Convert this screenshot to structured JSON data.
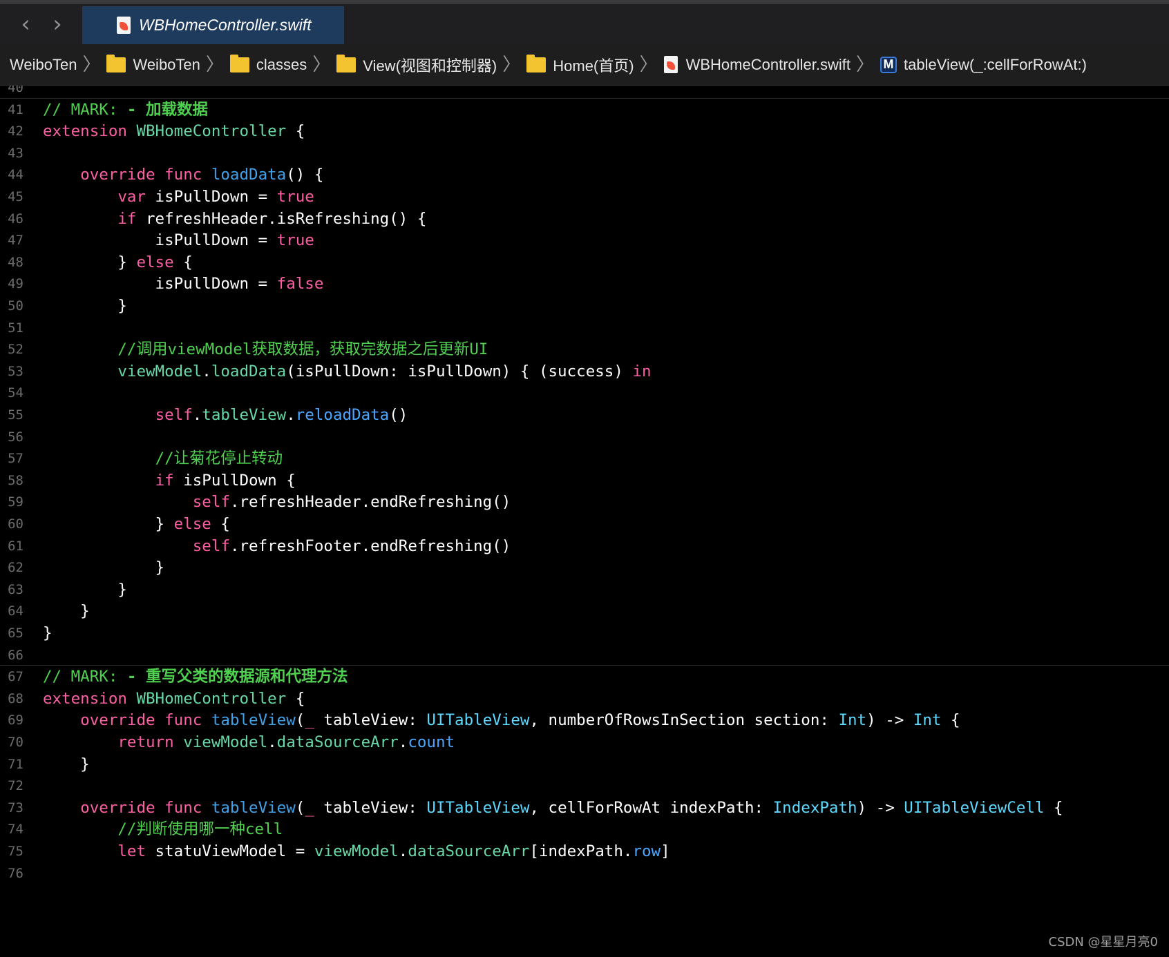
{
  "tab_bar": {
    "back_arrow": "chevron-left-icon",
    "forward_arrow": "chevron-right-icon",
    "active_tab": {
      "label": "WBHomeController.swift",
      "icon": "swift-file-icon"
    }
  },
  "breadcrumb": [
    {
      "label": "WeiboTen",
      "icon": ""
    },
    {
      "label": "WeiboTen",
      "icon": "folder-icon"
    },
    {
      "label": "classes",
      "icon": "folder-icon"
    },
    {
      "label": "View(视图和控制器)",
      "icon": "folder-icon"
    },
    {
      "label": "Home(首页)",
      "icon": "folder-icon"
    },
    {
      "label": "WBHomeController.swift",
      "icon": "swift-file-icon"
    },
    {
      "label": "tableView(_:cellForRowAt:)",
      "icon": "method-icon",
      "icon_text": "M"
    }
  ],
  "colors": {
    "keyword": "#fc5fa3",
    "comment": "#4fd04f",
    "type": "#5dd8ff",
    "function": "#41a1e8",
    "project_identifier": "#67d9a8",
    "plain": "#ffffff",
    "line_number": "#6c6c6c",
    "background": "#000000",
    "active_tab": "#1e3a5c"
  },
  "code_lines": [
    {
      "n": "40",
      "tokens": []
    },
    {
      "n": "41",
      "tokens": [
        [
          "comment",
          "// MARK: "
        ],
        [
          "mark",
          "- 加载数据"
        ]
      ]
    },
    {
      "n": "42",
      "tokens": [
        [
          "kw",
          "extension"
        ],
        [
          "plain",
          " "
        ],
        [
          "proj",
          "WBHomeController"
        ],
        [
          "plain",
          " {"
        ]
      ]
    },
    {
      "n": "43",
      "tokens": []
    },
    {
      "n": "44",
      "tokens": [
        [
          "plain",
          "    "
        ],
        [
          "kw",
          "override"
        ],
        [
          "plain",
          " "
        ],
        [
          "kw",
          "func"
        ],
        [
          "plain",
          " "
        ],
        [
          "fn",
          "loadData"
        ],
        [
          "plain",
          "() {"
        ]
      ]
    },
    {
      "n": "45",
      "tokens": [
        [
          "plain",
          "        "
        ],
        [
          "kw",
          "var"
        ],
        [
          "plain",
          " isPullDown = "
        ],
        [
          "kw",
          "true"
        ]
      ]
    },
    {
      "n": "46",
      "tokens": [
        [
          "plain",
          "        "
        ],
        [
          "kw",
          "if"
        ],
        [
          "plain",
          " refreshHeader.isRefreshing() {"
        ]
      ]
    },
    {
      "n": "47",
      "tokens": [
        [
          "plain",
          "            isPullDown = "
        ],
        [
          "kw",
          "true"
        ]
      ]
    },
    {
      "n": "48",
      "tokens": [
        [
          "plain",
          "        } "
        ],
        [
          "kw",
          "else"
        ],
        [
          "plain",
          " {"
        ]
      ]
    },
    {
      "n": "49",
      "tokens": [
        [
          "plain",
          "            isPullDown = "
        ],
        [
          "kw",
          "false"
        ]
      ]
    },
    {
      "n": "50",
      "tokens": [
        [
          "plain",
          "        }"
        ]
      ]
    },
    {
      "n": "51",
      "tokens": []
    },
    {
      "n": "52",
      "tokens": [
        [
          "plain",
          "        "
        ],
        [
          "comment",
          "//调用viewModel获取数据，获取完数据之后更新UI"
        ]
      ]
    },
    {
      "n": "53",
      "tokens": [
        [
          "plain",
          "        "
        ],
        [
          "proj",
          "viewModel"
        ],
        [
          "plain",
          "."
        ],
        [
          "proj",
          "loadData"
        ],
        [
          "plain",
          "(isPullDown: isPullDown) { (success) "
        ],
        [
          "kw",
          "in"
        ]
      ]
    },
    {
      "n": "54",
      "tokens": []
    },
    {
      "n": "55",
      "tokens": [
        [
          "plain",
          "            "
        ],
        [
          "kw",
          "self"
        ],
        [
          "plain",
          "."
        ],
        [
          "proj",
          "tableView"
        ],
        [
          "plain",
          "."
        ],
        [
          "sys",
          "reloadData"
        ],
        [
          "plain",
          "()"
        ]
      ]
    },
    {
      "n": "56",
      "tokens": []
    },
    {
      "n": "57",
      "tokens": [
        [
          "plain",
          "            "
        ],
        [
          "comment",
          "//让菊花停止转动"
        ]
      ]
    },
    {
      "n": "58",
      "tokens": [
        [
          "plain",
          "            "
        ],
        [
          "kw",
          "if"
        ],
        [
          "plain",
          " isPullDown {"
        ]
      ]
    },
    {
      "n": "59",
      "tokens": [
        [
          "plain",
          "                "
        ],
        [
          "kw",
          "self"
        ],
        [
          "plain",
          ".refreshHeader.endRefreshing()"
        ]
      ]
    },
    {
      "n": "60",
      "tokens": [
        [
          "plain",
          "            } "
        ],
        [
          "kw",
          "else"
        ],
        [
          "plain",
          " {"
        ]
      ]
    },
    {
      "n": "61",
      "tokens": [
        [
          "plain",
          "                "
        ],
        [
          "kw",
          "self"
        ],
        [
          "plain",
          ".refreshFooter.endRefreshing()"
        ]
      ]
    },
    {
      "n": "62",
      "tokens": [
        [
          "plain",
          "            }"
        ]
      ]
    },
    {
      "n": "63",
      "tokens": [
        [
          "plain",
          "        }"
        ]
      ]
    },
    {
      "n": "64",
      "tokens": [
        [
          "plain",
          "    }"
        ]
      ]
    },
    {
      "n": "65",
      "tokens": [
        [
          "plain",
          "}"
        ]
      ]
    },
    {
      "n": "66",
      "tokens": []
    },
    {
      "n": "67",
      "tokens": [
        [
          "comment",
          "// MARK: "
        ],
        [
          "mark",
          "- 重写父类的数据源和代理方法"
        ]
      ]
    },
    {
      "n": "68",
      "tokens": [
        [
          "kw",
          "extension"
        ],
        [
          "plain",
          " "
        ],
        [
          "proj",
          "WBHomeController"
        ],
        [
          "plain",
          " {"
        ]
      ]
    },
    {
      "n": "69",
      "tokens": [
        [
          "plain",
          "    "
        ],
        [
          "kw",
          "override"
        ],
        [
          "plain",
          " "
        ],
        [
          "kw",
          "func"
        ],
        [
          "plain",
          " "
        ],
        [
          "fn",
          "tableView"
        ],
        [
          "plain",
          "("
        ],
        [
          "kw",
          "_"
        ],
        [
          "plain",
          " tableView: "
        ],
        [
          "type",
          "UITableView"
        ],
        [
          "plain",
          ", numberOfRowsInSection section: "
        ],
        [
          "type",
          "Int"
        ],
        [
          "plain",
          ") -> "
        ],
        [
          "type",
          "Int"
        ],
        [
          "plain",
          " {"
        ]
      ]
    },
    {
      "n": "70",
      "tokens": [
        [
          "plain",
          "        "
        ],
        [
          "kw",
          "return"
        ],
        [
          "plain",
          " "
        ],
        [
          "proj",
          "viewModel"
        ],
        [
          "plain",
          "."
        ],
        [
          "proj",
          "dataSourceArr"
        ],
        [
          "plain",
          "."
        ],
        [
          "sys",
          "count"
        ]
      ]
    },
    {
      "n": "71",
      "tokens": [
        [
          "plain",
          "    }"
        ]
      ]
    },
    {
      "n": "72",
      "tokens": []
    },
    {
      "n": "73",
      "tokens": [
        [
          "plain",
          "    "
        ],
        [
          "kw",
          "override"
        ],
        [
          "plain",
          " "
        ],
        [
          "kw",
          "func"
        ],
        [
          "plain",
          " "
        ],
        [
          "fn",
          "tableView"
        ],
        [
          "plain",
          "("
        ],
        [
          "kw",
          "_"
        ],
        [
          "plain",
          " tableView: "
        ],
        [
          "type",
          "UITableView"
        ],
        [
          "plain",
          ", cellForRowAt indexPath: "
        ],
        [
          "type",
          "IndexPath"
        ],
        [
          "plain",
          ") -> "
        ],
        [
          "type",
          "UITableViewCell"
        ],
        [
          "plain",
          " {"
        ]
      ]
    },
    {
      "n": "74",
      "tokens": [
        [
          "plain",
          "        "
        ],
        [
          "comment",
          "//判断使用哪一种cell"
        ]
      ]
    },
    {
      "n": "75",
      "tokens": [
        [
          "plain",
          "        "
        ],
        [
          "kw",
          "let"
        ],
        [
          "plain",
          " statuViewModel = "
        ],
        [
          "proj",
          "viewModel"
        ],
        [
          "plain",
          "."
        ],
        [
          "proj",
          "dataSourceArr"
        ],
        [
          "plain",
          "[indexPath."
        ],
        [
          "sys",
          "row"
        ],
        [
          "plain",
          "]"
        ]
      ]
    },
    {
      "n": "76",
      "tokens": []
    }
  ],
  "watermark": "CSDN @星星月亮0"
}
